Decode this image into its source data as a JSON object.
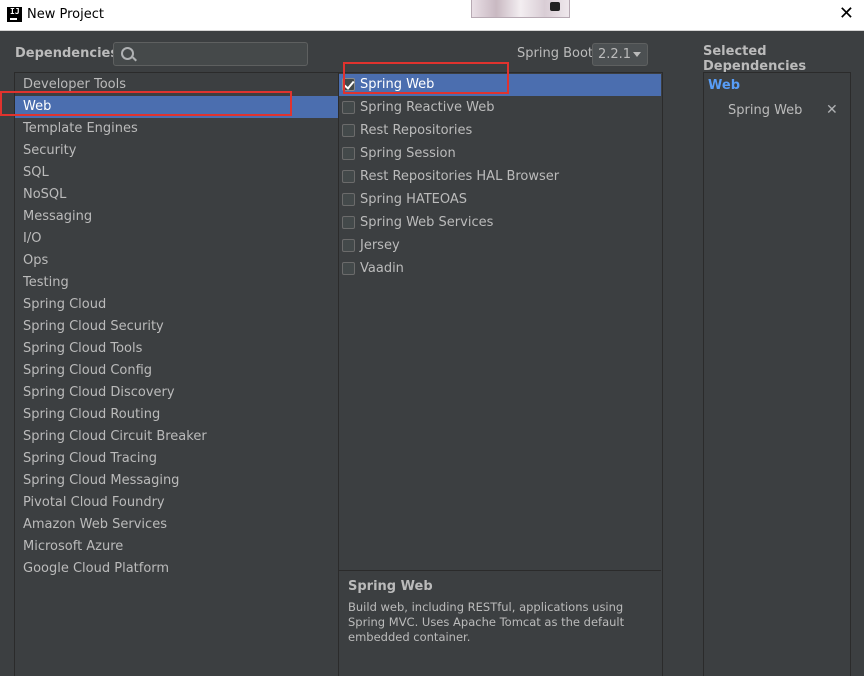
{
  "window": {
    "title": "New Project",
    "close_icon": "close-icon"
  },
  "header": {
    "dependencies_label": "Dependencies",
    "search_placeholder": "",
    "spring_boot_label": "Spring Boot",
    "spring_boot_version": "2.2.1",
    "selected_title": "Selected Dependencies"
  },
  "categories": [
    {
      "label": "Developer Tools"
    },
    {
      "label": "Web",
      "selected": true
    },
    {
      "label": "Template Engines"
    },
    {
      "label": "Security"
    },
    {
      "label": "SQL"
    },
    {
      "label": "NoSQL"
    },
    {
      "label": "Messaging"
    },
    {
      "label": "I/O"
    },
    {
      "label": "Ops"
    },
    {
      "label": "Testing"
    },
    {
      "label": "Spring Cloud"
    },
    {
      "label": "Spring Cloud Security"
    },
    {
      "label": "Spring Cloud Tools"
    },
    {
      "label": "Spring Cloud Config"
    },
    {
      "label": "Spring Cloud Discovery"
    },
    {
      "label": "Spring Cloud Routing"
    },
    {
      "label": "Spring Cloud Circuit Breaker"
    },
    {
      "label": "Spring Cloud Tracing"
    },
    {
      "label": "Spring Cloud Messaging"
    },
    {
      "label": "Pivotal Cloud Foundry"
    },
    {
      "label": "Amazon Web Services"
    },
    {
      "label": "Microsoft Azure"
    },
    {
      "label": "Google Cloud Platform"
    }
  ],
  "dependencies": [
    {
      "label": "Spring Web",
      "checked": true,
      "selected": true
    },
    {
      "label": "Spring Reactive Web",
      "checked": false
    },
    {
      "label": "Rest Repositories",
      "checked": false
    },
    {
      "label": "Spring Session",
      "checked": false
    },
    {
      "label": "Rest Repositories HAL Browser",
      "checked": false
    },
    {
      "label": "Spring HATEOAS",
      "checked": false
    },
    {
      "label": "Spring Web Services",
      "checked": false
    },
    {
      "label": "Jersey",
      "checked": false
    },
    {
      "label": "Vaadin",
      "checked": false
    }
  ],
  "description": {
    "title": "Spring Web",
    "text": "Build web, including RESTful, applications using Spring MVC. Uses Apache Tomcat as the default embedded container."
  },
  "selected": {
    "group": "Web",
    "items": [
      "Spring Web"
    ]
  },
  "colors": {
    "background": "#3c3f41",
    "selection": "#4b6eaf",
    "group_accent": "#589df6",
    "annotation": "#e0332e"
  }
}
